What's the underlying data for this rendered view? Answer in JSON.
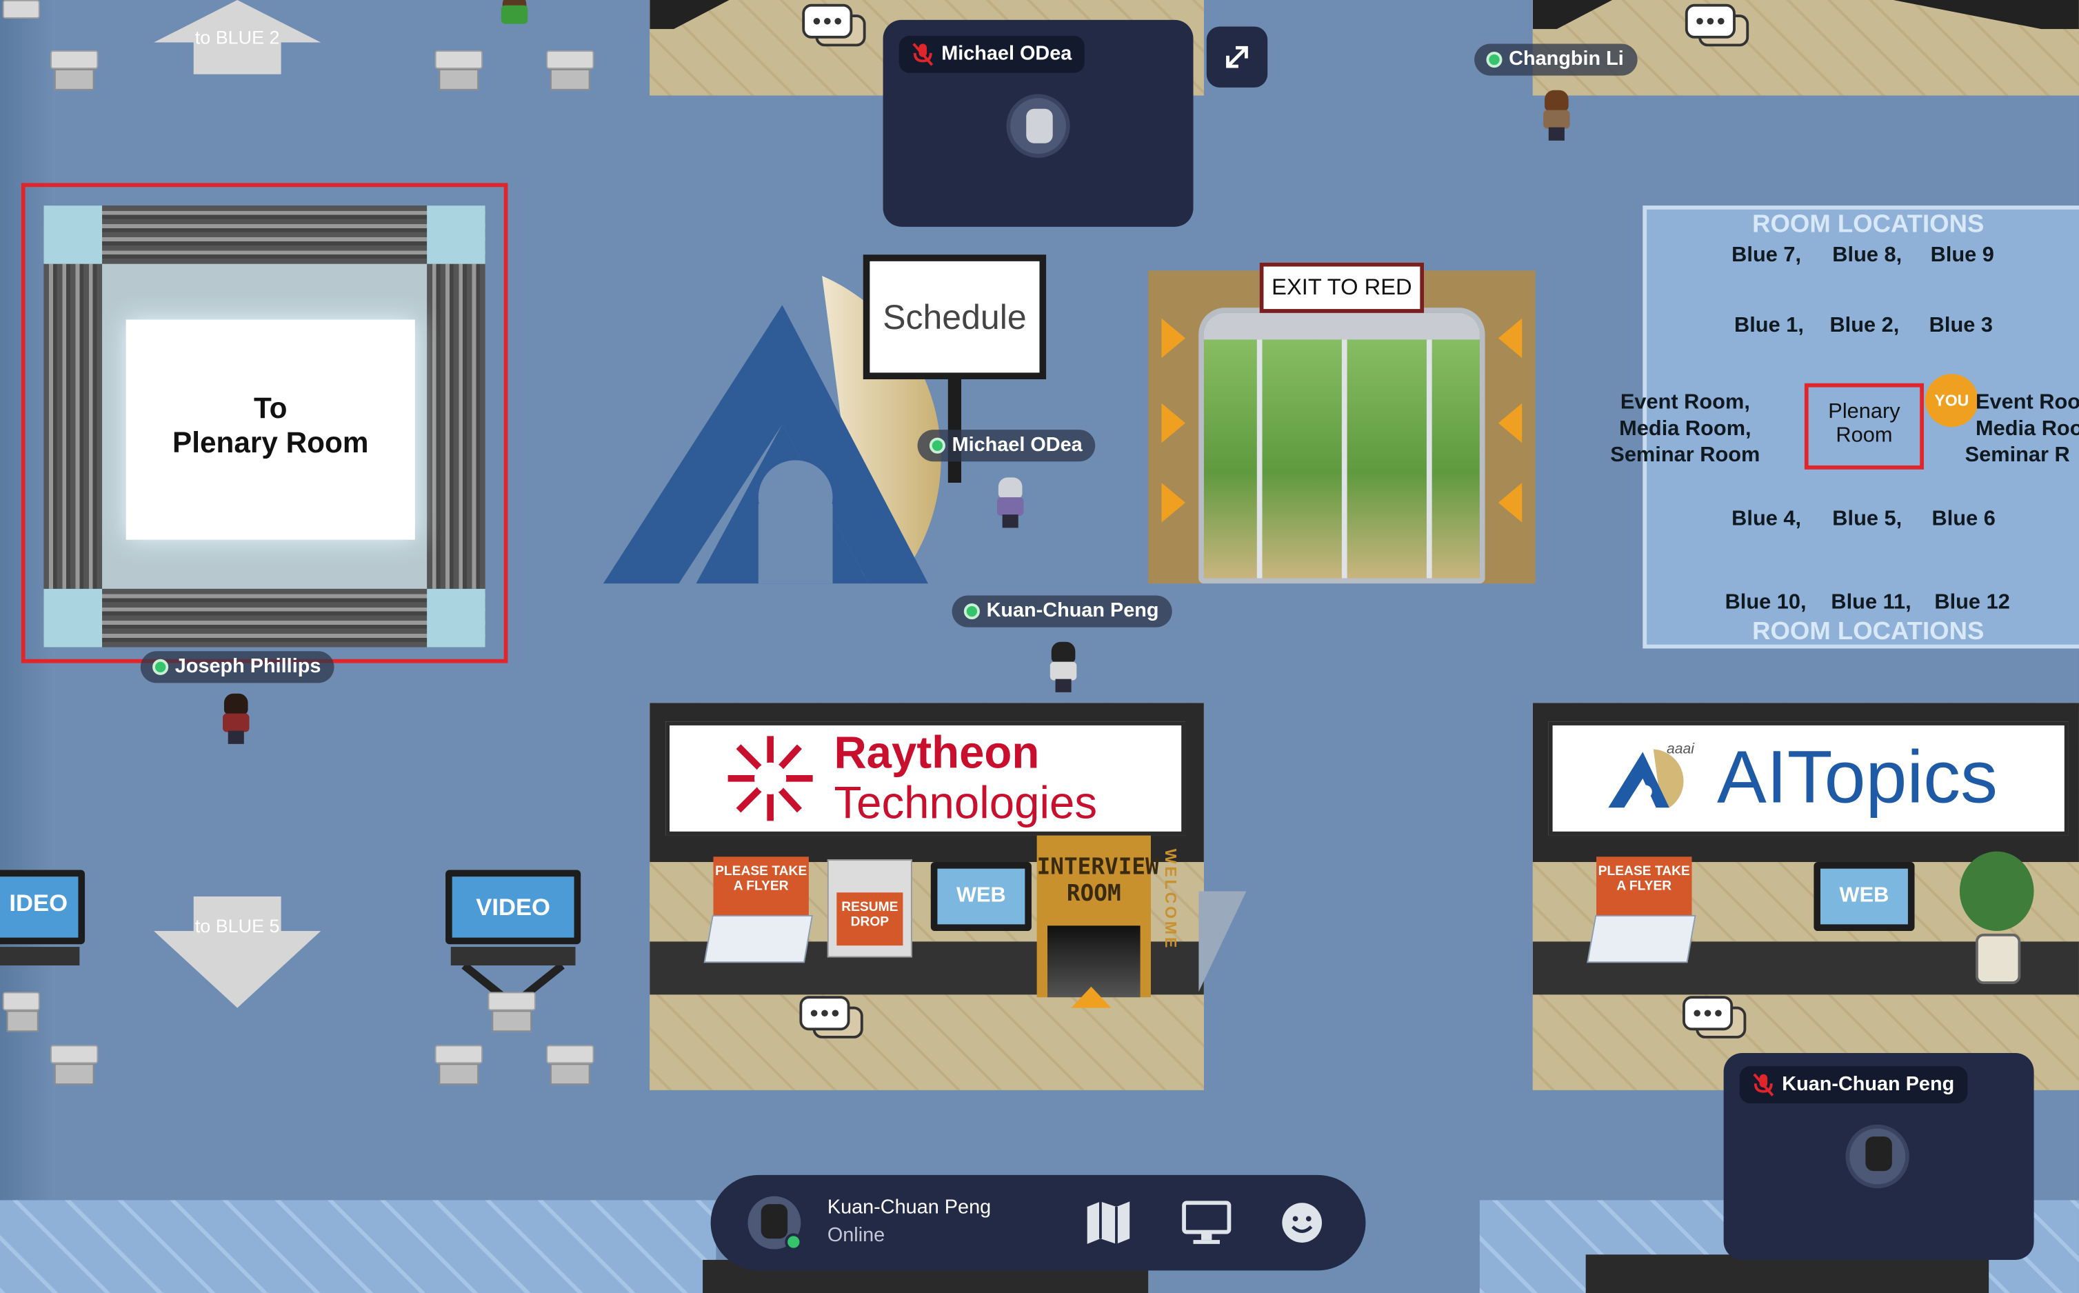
{
  "nav": {
    "to_blue_2": "to BLUE 2",
    "to_blue_5": "to BLUE 5"
  },
  "portal": {
    "line1": "To",
    "line2": "Plenary Room"
  },
  "schedule_sign": "Schedule",
  "exit_sign": "EXIT TO RED",
  "players": [
    {
      "name": "Michael ODea"
    },
    {
      "name": "Kuan-Chuan Peng"
    },
    {
      "name": "Joseph Phillips"
    },
    {
      "name": "Changbin Li"
    }
  ],
  "video_tiles": {
    "top": {
      "name": "Michael ODea"
    },
    "bottom": {
      "name": "Kuan-Chuan Peng"
    }
  },
  "room_map": {
    "header_top": "ROOM LOCATIONS",
    "header_bottom": "ROOM LOCATIONS",
    "row1": [
      "Blue 7,",
      "Blue 8,",
      "Blue 9"
    ],
    "row2": [
      "Blue 1,",
      "Blue 2,",
      "Blue 3"
    ],
    "left_col": [
      "Event Room,",
      "Media Room,",
      "Seminar Room"
    ],
    "center": [
      "Plenary",
      "Room"
    ],
    "you_badge": "YOU",
    "right_col": [
      "Event Roo",
      "Media Roo",
      "Seminar R"
    ],
    "row3": [
      "Blue 4,",
      "Blue 5,",
      "Blue 6"
    ],
    "row4": [
      "Blue 10,",
      "Blue 11,",
      "Blue 12"
    ]
  },
  "raytheon_booth": {
    "brand_line1": "Raytheon",
    "brand_line2": "Technologies",
    "flyer": "PLEASE TAKE A FLYER",
    "resume": "RESUME DROP",
    "web": "WEB",
    "interview_line1": "INTERVIEW",
    "interview_line2": "ROOM",
    "welcome": "WELCOME"
  },
  "aitopics_booth": {
    "aaai": "aaai",
    "brand": "AITopics",
    "flyer": "PLEASE TAKE A FLYER",
    "web": "WEB"
  },
  "video_monitor": {
    "left": "IDEO",
    "right": "VIDEO"
  },
  "status_bar": {
    "user_name": "Kuan-Chuan Peng",
    "status": "Online",
    "icons": [
      "map-icon",
      "screen-share-icon",
      "emoji-icon"
    ]
  },
  "colors": {
    "floor": "#6f8db3",
    "raytheon_red": "#c8102e",
    "aitopics_blue": "#1f5aa6",
    "highlight_red": "#e0262b",
    "online_green": "#35c46b",
    "you_orange": "#f0a020"
  }
}
